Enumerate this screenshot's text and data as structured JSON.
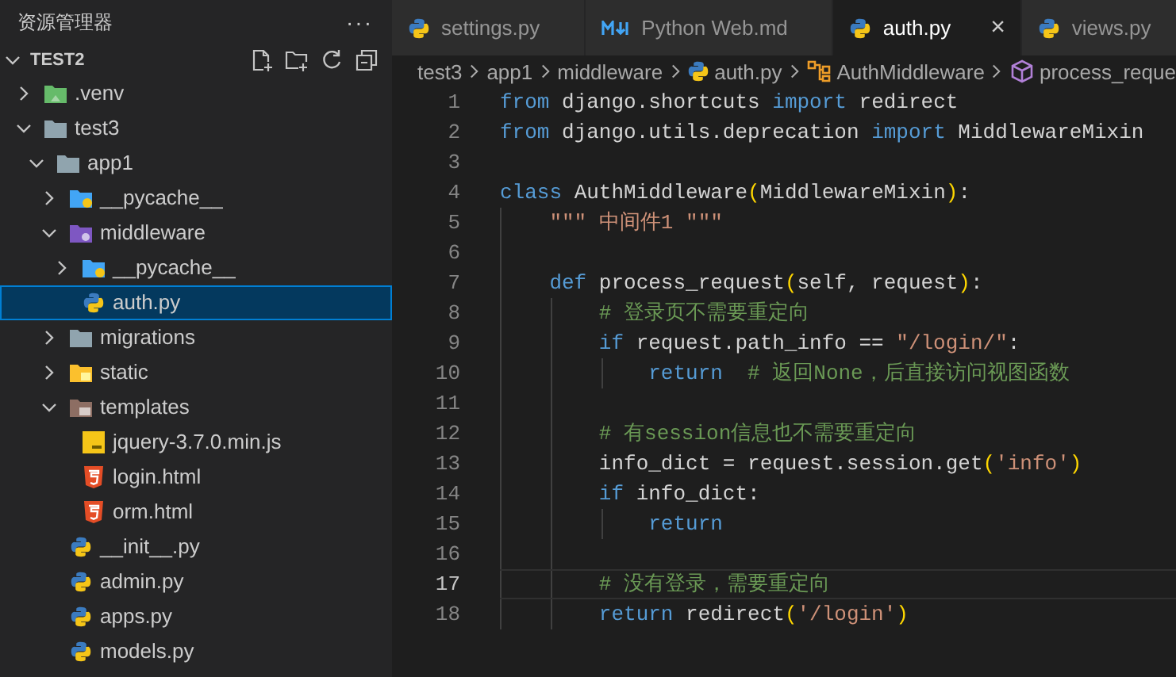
{
  "sidebar": {
    "title": "资源管理器",
    "more": "···",
    "root": {
      "label": "TEST2",
      "expanded": true
    },
    "tree": [
      {
        "label": ".venv",
        "kind": "venv-folder",
        "expanded": false,
        "selected": false
      },
      {
        "label": "test3",
        "kind": "folder",
        "expanded": true,
        "selected": false,
        "children": [
          {
            "label": "app1",
            "kind": "folder",
            "expanded": true,
            "selected": false,
            "children": [
              {
                "label": "__pycache__",
                "kind": "pycache-folder",
                "expanded": false,
                "selected": false
              },
              {
                "label": "middleware",
                "kind": "middleware-folder",
                "expanded": true,
                "selected": false,
                "children": [
                  {
                    "label": "__pycache__",
                    "kind": "pycache-folder",
                    "expanded": false,
                    "selected": false
                  },
                  {
                    "label": "auth.py",
                    "kind": "python",
                    "selected": true
                  }
                ]
              },
              {
                "label": "migrations",
                "kind": "folder",
                "expanded": false,
                "selected": false
              },
              {
                "label": "static",
                "kind": "static-folder",
                "expanded": false,
                "selected": false
              },
              {
                "label": "templates",
                "kind": "templates-folder",
                "expanded": true,
                "selected": false,
                "children": [
                  {
                    "label": "jquery-3.7.0.min.js",
                    "kind": "js",
                    "selected": false
                  },
                  {
                    "label": "login.html",
                    "kind": "html",
                    "selected": false
                  },
                  {
                    "label": "orm.html",
                    "kind": "html",
                    "selected": false
                  }
                ]
              },
              {
                "label": "__init__.py",
                "kind": "python",
                "selected": false
              },
              {
                "label": "admin.py",
                "kind": "python",
                "selected": false
              },
              {
                "label": "apps.py",
                "kind": "python",
                "selected": false
              },
              {
                "label": "models.py",
                "kind": "python",
                "selected": false
              }
            ]
          }
        ]
      }
    ]
  },
  "tabs": [
    {
      "label": "settings.py",
      "kind": "python",
      "selected": false
    },
    {
      "label": "Python Web.md",
      "kind": "markdown",
      "selected": false
    },
    {
      "label": "auth.py",
      "kind": "python",
      "selected": true,
      "close": "×"
    },
    {
      "label": "views.py",
      "kind": "python",
      "selected": false
    }
  ],
  "breadcrumb": [
    {
      "label": "test3",
      "kind": "folder"
    },
    {
      "label": "app1",
      "kind": "folder"
    },
    {
      "label": "middleware",
      "kind": "folder"
    },
    {
      "label": "auth.py",
      "kind": "python"
    },
    {
      "label": "AuthMiddleware",
      "kind": "class"
    },
    {
      "label": "process_reque",
      "kind": "method"
    }
  ],
  "code": [
    {
      "number": "1",
      "current": false,
      "tokens": [
        {
          "kind": "kw",
          "text": "from"
        },
        {
          "kind": "plain",
          "text": " django.shortcuts "
        },
        {
          "kind": "kw",
          "text": "import"
        },
        {
          "kind": "plain",
          "text": " redirect"
        }
      ]
    },
    {
      "number": "2",
      "current": false,
      "tokens": [
        {
          "kind": "kw",
          "text": "from"
        },
        {
          "kind": "plain",
          "text": " django.utils.deprecation "
        },
        {
          "kind": "kw",
          "text": "import"
        },
        {
          "kind": "plain",
          "text": " MiddlewareMixin"
        }
      ]
    },
    {
      "number": "3",
      "current": false
    },
    {
      "number": "4",
      "current": false,
      "tokens": [
        {
          "kind": "kw",
          "text": "class"
        },
        {
          "kind": "plain",
          "text": " AuthMiddleware"
        },
        {
          "kind": "paren",
          "text": "("
        },
        {
          "kind": "plain",
          "text": "MiddlewareMixin"
        },
        {
          "kind": "paren",
          "text": ")"
        },
        {
          "kind": "plain",
          "text": ":"
        }
      ]
    },
    {
      "number": "5",
      "current": false,
      "tokens": [
        {
          "kind": "str",
          "text": "    \"\"\" 中间件1 \"\"\""
        }
      ]
    },
    {
      "number": "6",
      "current": false
    },
    {
      "number": "7",
      "current": false,
      "tokens": [
        {
          "kind": "kw",
          "text": "    def"
        },
        {
          "kind": "plain",
          "text": " process_request"
        },
        {
          "kind": "paren",
          "text": "("
        },
        {
          "kind": "plain",
          "text": "self, request"
        },
        {
          "kind": "paren",
          "text": ")"
        },
        {
          "kind": "plain",
          "text": ":"
        }
      ]
    },
    {
      "number": "8",
      "current": false,
      "tokens": [
        {
          "kind": "cmt",
          "text": "        # 登录页不需要重定向"
        }
      ]
    },
    {
      "number": "9",
      "current": false,
      "tokens": [
        {
          "kind": "kw",
          "text": "        if"
        },
        {
          "kind": "plain",
          "text": " request.path_info == "
        },
        {
          "kind": "str",
          "text": "\"/login/\""
        },
        {
          "kind": "plain",
          "text": ":"
        }
      ]
    },
    {
      "number": "10",
      "current": false,
      "tokens": [
        {
          "kind": "kw",
          "text": "            return"
        },
        {
          "kind": "cmt",
          "text": "  # 返回None，后直接访问视图函数"
        }
      ]
    },
    {
      "number": "11",
      "current": false
    },
    {
      "number": "12",
      "current": false,
      "tokens": [
        {
          "kind": "cmt",
          "text": "        # 有session信息也不需要重定向"
        }
      ]
    },
    {
      "number": "13",
      "current": false,
      "tokens": [
        {
          "kind": "plain",
          "text": "        info_dict = request.session.get"
        },
        {
          "kind": "paren",
          "text": "("
        },
        {
          "kind": "str",
          "text": "'info'"
        },
        {
          "kind": "paren",
          "text": ")"
        }
      ]
    },
    {
      "number": "14",
      "current": false,
      "tokens": [
        {
          "kind": "kw",
          "text": "        if"
        },
        {
          "kind": "plain",
          "text": " info_dict:"
        }
      ]
    },
    {
      "number": "15",
      "current": false,
      "tokens": [
        {
          "kind": "kw",
          "text": "            return"
        }
      ]
    },
    {
      "number": "16",
      "current": false
    },
    {
      "number": "17",
      "current": true,
      "tokens": [
        {
          "kind": "cmt",
          "text": "        # 没有登录，需要重定向"
        }
      ]
    },
    {
      "number": "18",
      "current": false,
      "tokens": [
        {
          "kind": "kw",
          "text": "        return"
        },
        {
          "kind": "plain",
          "text": " redirect"
        },
        {
          "kind": "paren",
          "text": "("
        },
        {
          "kind": "str",
          "text": "'/login'"
        },
        {
          "kind": "paren",
          "text": ")"
        }
      ]
    }
  ]
}
